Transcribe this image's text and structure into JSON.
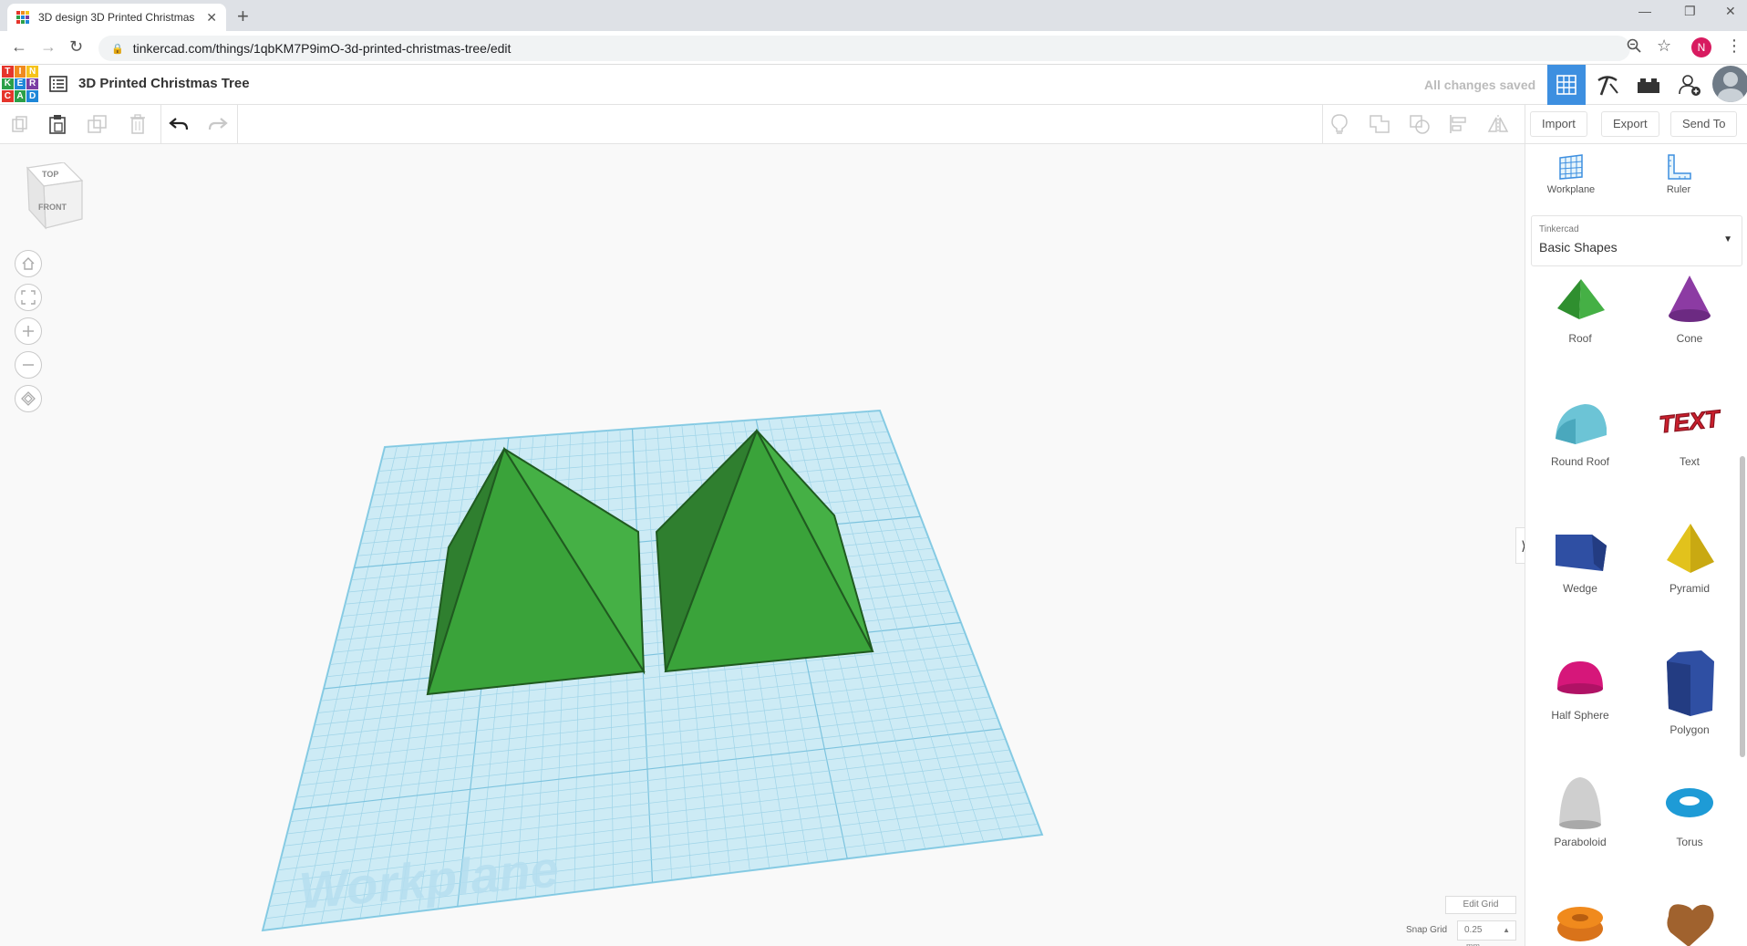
{
  "browser": {
    "tab_title": "3D design 3D Printed Christmas",
    "tab_close": "✕",
    "new_tab": "+",
    "url": "tinkercad.com/things/1qbKM7P9imO-3d-printed-christmas-tree/edit",
    "profile_initial": "N"
  },
  "app": {
    "logo_letters": [
      "T",
      "I",
      "N",
      "K",
      "E",
      "R",
      "C",
      "A",
      "D"
    ],
    "logo_colors": [
      "#e5352b",
      "#f08a1d",
      "#f6c31b",
      "#2b9f48",
      "#1e87d8",
      "#7b3ea3",
      "#e5352b",
      "#2b9f48",
      "#1e87d8"
    ],
    "design_title": "3D Printed Christmas Tree",
    "save_status": "All changes saved",
    "accent_color": "#3d8fe0"
  },
  "toolbar": {
    "import_label": "Import",
    "export_label": "Export",
    "send_to_label": "Send To"
  },
  "viewcube": {
    "top_label": "TOP",
    "front_label": "FRONT"
  },
  "workplane": {
    "watermark": "Workplane",
    "grid_color": "#a8dbee",
    "shape_color": "#3fa83f"
  },
  "grid_settings": {
    "edit_grid_label": "Edit Grid",
    "snap_grid_label": "Snap Grid",
    "snap_grid_value": "0.25",
    "snap_unit": "mm"
  },
  "panel": {
    "workplane_label": "Workplane",
    "ruler_label": "Ruler",
    "library_source": "Tinkercad",
    "library_name": "Basic Shapes",
    "shapes": [
      {
        "label": "Roof",
        "icon": "roof-icon"
      },
      {
        "label": "Cone",
        "icon": "cone-icon"
      },
      {
        "label": "Round Roof",
        "icon": "round-roof-icon"
      },
      {
        "label": "Text",
        "icon": "text-shape-icon",
        "text": "TEXT"
      },
      {
        "label": "Wedge",
        "icon": "wedge-icon"
      },
      {
        "label": "Pyramid",
        "icon": "pyramid-icon"
      },
      {
        "label": "Half Sphere",
        "icon": "half-sphere-icon"
      },
      {
        "label": "Polygon",
        "icon": "polygon-icon"
      },
      {
        "label": "Paraboloid",
        "icon": "paraboloid-icon"
      },
      {
        "label": "Torus",
        "icon": "torus-icon"
      },
      {
        "label": "Tube",
        "icon": "tube-icon"
      },
      {
        "label": "Heart",
        "icon": "heart-icon"
      }
    ]
  }
}
